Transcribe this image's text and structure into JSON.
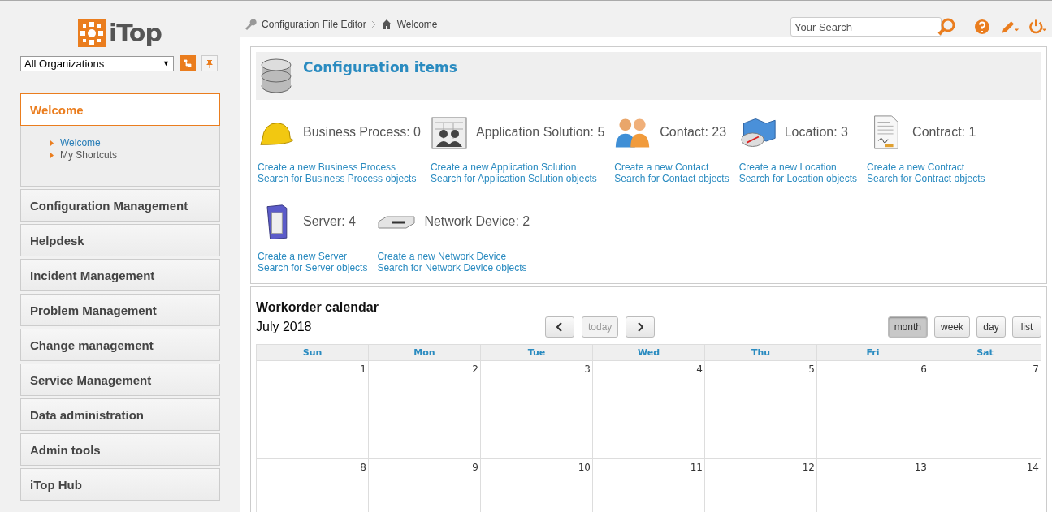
{
  "logo": {
    "text": "iTop"
  },
  "org_select": {
    "value": "All Organizations",
    "caret": "▼"
  },
  "menu": [
    {
      "label": "Welcome",
      "expanded": true,
      "children": [
        {
          "label": "Welcome",
          "selected": true
        },
        {
          "label": "My Shortcuts",
          "selected": false
        }
      ]
    },
    {
      "label": "Configuration Management",
      "expanded": false
    },
    {
      "label": "Helpdesk",
      "expanded": false
    },
    {
      "label": "Incident Management",
      "expanded": false
    },
    {
      "label": "Problem Management",
      "expanded": false
    },
    {
      "label": "Change management",
      "expanded": false
    },
    {
      "label": "Service Management",
      "expanded": false
    },
    {
      "label": "Data administration",
      "expanded": false
    },
    {
      "label": "Admin tools",
      "expanded": false
    },
    {
      "label": "iTop Hub",
      "expanded": false
    }
  ],
  "breadcrumb": [
    {
      "label": "Configuration File Editor",
      "kind": "tool"
    },
    {
      "label": "Welcome",
      "kind": "home"
    }
  ],
  "search": {
    "placeholder": "Your Search"
  },
  "ci_panel": {
    "title": "Configuration items",
    "rows": [
      [
        {
          "kind": "helmet",
          "label": "Business Process: 0",
          "create": "Create a new Business Process",
          "search": "Search for Business Process objects"
        },
        {
          "kind": "app",
          "label": "Application Solution: 5",
          "create": "Create a new Application Solution",
          "search": "Search for Application Solution objects"
        },
        {
          "kind": "contact",
          "label": "Contact: 23",
          "create": "Create a new Contact",
          "search": "Search for Contact objects"
        },
        {
          "kind": "location",
          "label": "Location: 3",
          "create": "Create a new Location",
          "search": "Search for Location objects"
        },
        {
          "kind": "contract",
          "label": "Contract: 1",
          "create": "Create a new Contract",
          "search": "Search for Contract objects"
        }
      ],
      [
        {
          "kind": "server",
          "label": "Server: 4",
          "create": "Create a new Server",
          "search": "Search for Server objects"
        },
        {
          "kind": "network",
          "label": "Network Device: 2",
          "create": "Create a new Network Device",
          "search": "Search for Network Device objects"
        }
      ]
    ]
  },
  "calendar": {
    "title": "Workorder calendar",
    "month": "July 2018",
    "today": {
      "label": "today",
      "disabled": true
    },
    "views": [
      {
        "label": "month",
        "selected": true
      },
      {
        "label": "week",
        "selected": false
      },
      {
        "label": "day",
        "selected": false
      },
      {
        "label": "list",
        "selected": false
      }
    ],
    "days": [
      "Sun",
      "Mon",
      "Tue",
      "Wed",
      "Thu",
      "Fri",
      "Sat"
    ],
    "weeks": [
      [
        "1",
        "2",
        "3",
        "4",
        "5",
        "6",
        "7"
      ],
      [
        "8",
        "9",
        "10",
        "11",
        "12",
        "13",
        "14"
      ]
    ]
  }
}
